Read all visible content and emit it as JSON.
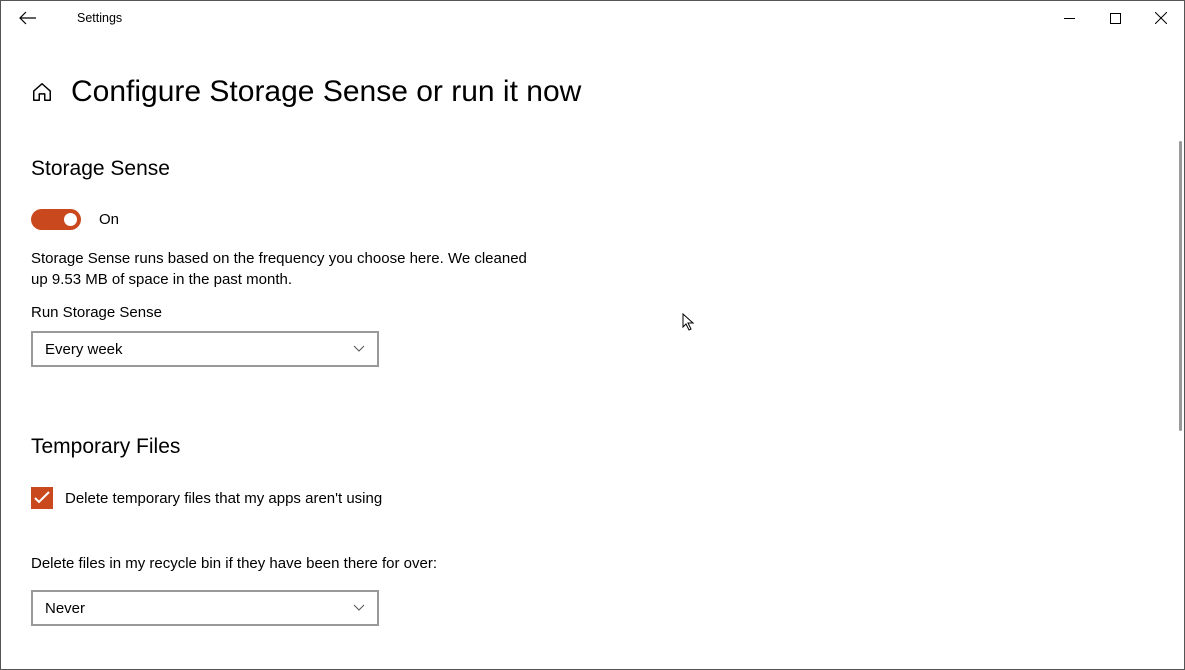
{
  "titlebar": {
    "title": "Settings"
  },
  "page": {
    "title": "Configure Storage Sense or run it now"
  },
  "section1": {
    "title": "Storage Sense",
    "toggle_state": "On",
    "description": "Storage Sense runs based on the frequency you choose here. We cleaned up 9.53 MB of space in the past month.",
    "run_label": "Run Storage Sense",
    "run_dropdown_value": "Every week"
  },
  "section2": {
    "title": "Temporary Files",
    "checkbox_label": "Delete temporary files that my apps aren't using",
    "recycle_label": "Delete files in my recycle bin if they have been there for over:",
    "recycle_dropdown_value": "Never"
  }
}
